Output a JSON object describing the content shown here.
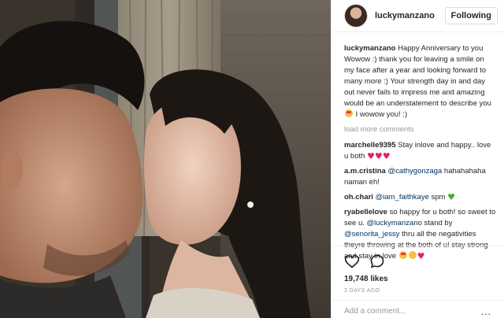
{
  "header": {
    "username": "luckymanzano",
    "follow_label": "Following"
  },
  "caption": {
    "user": "luckymanzano",
    "text": "Happy Anniversary to you Wowow :) thank you for leaving a smile on my face after a year and looking forward to many more :) Your strength day in and day out never fails to impress me and amazing would be an understatement to describe you",
    "text_end": "I wowow you! :)",
    "emoji": "heart-eyes-emoji"
  },
  "load_more_label": "load more comments",
  "comments": [
    {
      "user": "marchelle9395",
      "text": "Stay inlove and happy.. love u both",
      "emoji": "red-hearts-emoji"
    },
    {
      "user": "a.m.cristina",
      "mention": "@cathygonzaga",
      "text": "hahahahaha naman eh!"
    },
    {
      "user": "oh.chari",
      "mention": "@iam_faithkaye",
      "text": "spm",
      "emoji": "green-heart-emoji"
    },
    {
      "user": "ryabellelove",
      "text_a": "so happy for u both! so sweet to see u.",
      "mention_a": "@luckymanzano",
      "text_b": "stand by",
      "mention_b": "@senorita_jessy",
      "text_c": "thru all the negativities theyre throwing at the both of u! stay strong and stay in love",
      "emoji": "faces-heart-emoji"
    }
  ],
  "likes": "19,748 likes",
  "timestamp": "3 DAYS AGO",
  "add_comment": {
    "placeholder": "Add a comment..."
  },
  "more_label": "..."
}
